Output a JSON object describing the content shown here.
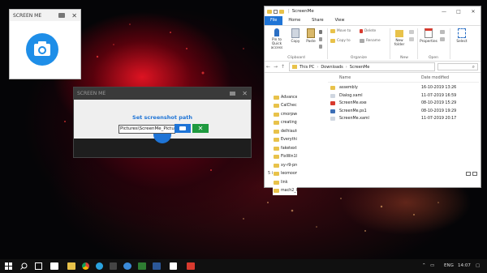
{
  "screen_me_app": {
    "title": "SCREEN ME",
    "folder_icon": "folder-icon",
    "close_glyph": "✕",
    "camera_icon": "camera-icon",
    "camera_color": "#1e8ee8"
  },
  "dialog": {
    "title": "SCREEN ME",
    "close_glyph": "✕",
    "heading": "Set screenshot path",
    "path_value": "Pictures\\ScreenMe_Picture.jpg",
    "browse_icon": "folder-icon",
    "confirm_glyph": "✕",
    "accent_color": "#1e74d6",
    "confirm_color": "#1f9a3f"
  },
  "desktop_folder_list": [
    "AdvancedWinS...",
    "CalCheck2.5.2_...",
    "cmorpwd-5.0",
    "creating_torrent",
    "delhiauto-fee",
    "Everything-1.4.1...",
    "faketext",
    "FixWin10",
    "xy-r9-press-kit",
    "leomoon-dot-c...",
    "link",
    "mach2_0.3.0.0_..."
  ],
  "explorer": {
    "title": "ScreenMe",
    "quick_access_sep": "|",
    "window_controls": [
      "—",
      "□",
      "✕"
    ],
    "tabs": [
      "File",
      "Home",
      "Share",
      "View"
    ],
    "ribbon": {
      "pin_label": "Pin to Quick access",
      "copy_label": "Copy",
      "paste_label": "Paste",
      "move_to": "Move to",
      "copy_to": "Copy to",
      "delete": "Delete",
      "rename": "Rename",
      "new_folder": "New folder",
      "properties": "Properties",
      "select": "Select",
      "groups": [
        "Clipboard",
        "Organize",
        "New",
        "Open"
      ]
    },
    "address": {
      "back": "←",
      "forward": "→",
      "up": "↑",
      "path": [
        "This PC",
        "Downloads",
        "ScreenMe"
      ],
      "separator": "›",
      "search_glyph": "⌕"
    },
    "columns": [
      "Name",
      "Date modified"
    ],
    "files": [
      {
        "name": "assembly",
        "date": "16-10-2019 13:26",
        "icon": "folder-icon",
        "color": "#e8c24a"
      },
      {
        "name": "Dialog.xaml",
        "date": "11-07-2019 16:59",
        "icon": "xaml-file-icon",
        "color": "#cfd6e0"
      },
      {
        "name": "ScreenMe.exe",
        "date": "08-10-2019 15:29",
        "icon": "exe-file-icon",
        "color": "#d83a2e"
      },
      {
        "name": "ScreenMe.ps1",
        "date": "08-10-2019 19:29",
        "icon": "ps1-file-icon",
        "color": "#3d6fb6"
      },
      {
        "name": "ScreenMe.xaml",
        "date": "11-07-2019 20:17",
        "icon": "xaml-file-icon",
        "color": "#cfd6e0"
      }
    ],
    "status": "5 items"
  },
  "taskbar": {
    "start_icon": "windows-start-icon",
    "search_icon": "search-icon",
    "pinned_icons": [
      "task-view-icon",
      "file-explorer-icon",
      "chrome-icon",
      "edge-icon",
      "app-icon",
      "screenme-icon",
      "app-icon-2",
      "app-icon-3"
    ],
    "language": "ENG",
    "time": "14:07",
    "notification_icon": "notification-icon"
  }
}
